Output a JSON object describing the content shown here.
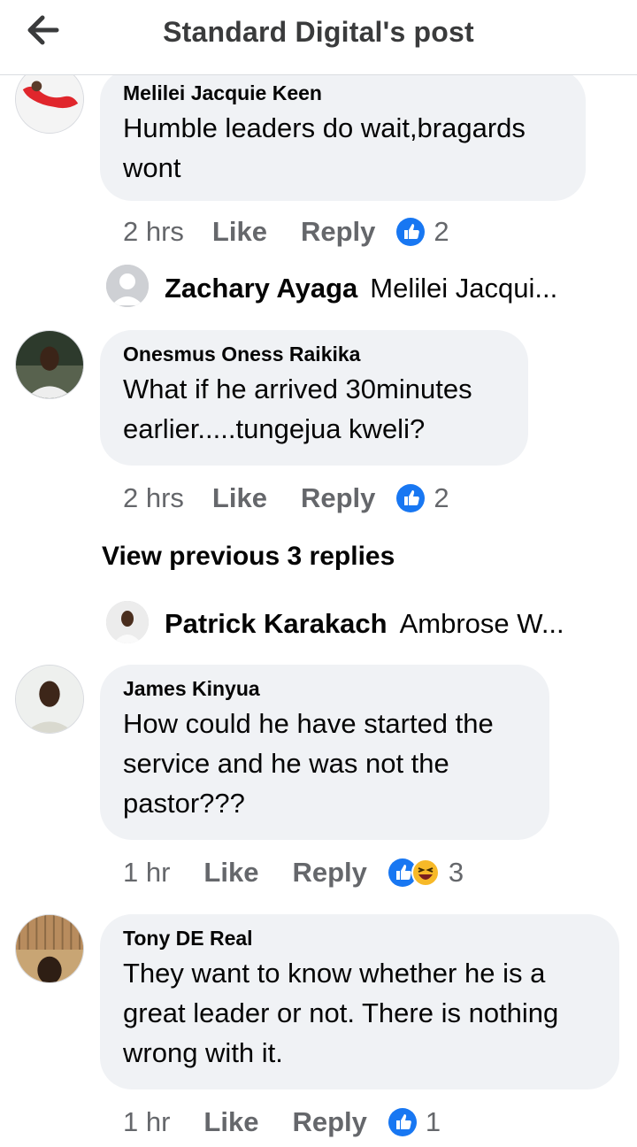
{
  "header": {
    "title": "Standard Digital's post"
  },
  "comments": [
    {
      "author": "Melilei Jacquie Keen",
      "lines": [
        "Humble leaders do wait,bragards",
        "wont"
      ],
      "time": "2 hrs",
      "like": "Like",
      "reply": "Reply",
      "reactions": "2",
      "reply_preview": {
        "name": "Zachary Ayaga",
        "text": "Melilei Jacqui..."
      }
    },
    {
      "author": "Onesmus Oness Raikika",
      "lines": [
        "What if he arrived 30minutes",
        "earlier.....tungejua kweli?"
      ],
      "time": "2 hrs",
      "like": "Like",
      "reply": "Reply",
      "reactions": "2",
      "view_previous": "View previous 3 replies",
      "reply_preview": {
        "name": "Patrick Karakach",
        "text": "Ambrose W..."
      }
    },
    {
      "author": "James Kinyua",
      "lines": [
        "How could he have started the",
        "service and he was not the",
        "pastor???"
      ],
      "time": "1 hr",
      "like": "Like",
      "reply": "Reply",
      "reactions": "3"
    },
    {
      "author": "Tony DE Real",
      "lines": [
        "They want to know whether he is a",
        "great leader or not. There is nothing",
        "wrong with it."
      ],
      "time": "1 hr",
      "like": "Like",
      "reply": "Reply",
      "reactions": "1"
    }
  ],
  "colors": {
    "like_blue": "#1877f2",
    "haha_yellow": "#f7b928",
    "bubble": "#f0f2f5",
    "meta_gray": "#65676b"
  },
  "icons": {
    "back": "arrow-left-icon",
    "like_reaction": "thumbs-up-icon",
    "haha_reaction": "laughing-face-icon"
  }
}
